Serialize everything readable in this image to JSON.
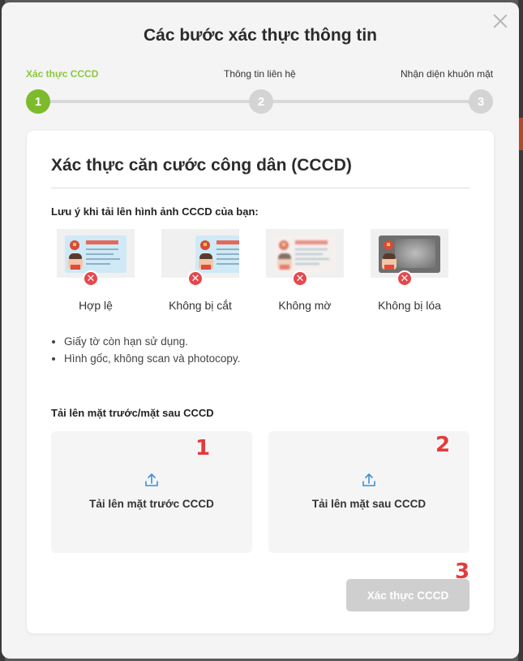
{
  "modal": {
    "title": "Các bước xác thực thông tin",
    "steps": [
      {
        "label": "Xác thực CCCD",
        "number": "1",
        "active": true
      },
      {
        "label": "Thông tin liên hệ",
        "number": "2",
        "active": false
      },
      {
        "label": "Nhận diện khuôn mặt",
        "number": "3",
        "active": false
      }
    ]
  },
  "card": {
    "title": "Xác thực căn cước công dân (CCCD)",
    "note_title": "Lưu ý khi tải lên hình ảnh CCCD của bạn:",
    "examples": [
      {
        "label": "Hợp lệ",
        "icon": "x-circle-icon"
      },
      {
        "label": "Không bị cắt",
        "icon": "x-circle-icon"
      },
      {
        "label": "Không mờ",
        "icon": "x-circle-icon"
      },
      {
        "label": "Không bị lóa",
        "icon": "x-circle-icon"
      }
    ],
    "bullets": [
      "Giấy tờ còn hạn sử dụng.",
      "Hình gốc, không scan và photocopy."
    ],
    "upload_title": "Tải lên mặt trước/mặt sau CCCD",
    "upload_front_label": "Tải lên mặt trước CCCD",
    "upload_back_label": "Tải lên mặt sau CCCD",
    "submit_label": "Xác thực CCCD",
    "markers": [
      "1",
      "2",
      "3"
    ]
  },
  "colors": {
    "accent": "#7dbb2c",
    "inactive_step": "#d4d4d4",
    "error": "#e5484d",
    "marker": "#e23b3b",
    "upload_icon": "#3a8fd8"
  }
}
